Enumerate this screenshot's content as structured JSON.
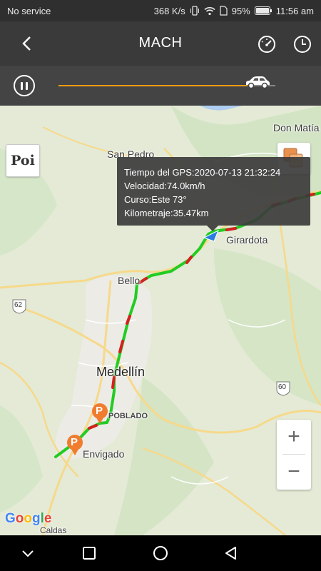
{
  "status_bar": {
    "carrier": "No service",
    "speed": "368 K/s",
    "battery": "95%",
    "time": "11:56 am"
  },
  "header": {
    "title": "MACH",
    "icons": [
      "back-icon",
      "speedometer-icon",
      "clock-icon"
    ]
  },
  "playback": {
    "state": "paused",
    "progress": 0.87
  },
  "map": {
    "poi_label": "Poi",
    "places": {
      "don_matias": "Don Matía",
      "san_pedro": "San Pedro",
      "girardota": "Girardota",
      "bello": "Bello",
      "medellin": "Medellín",
      "poblado": "POBLADO",
      "envigado": "Envigado",
      "caldas": "Caldas",
      "route_62": "62",
      "route_60": "60"
    },
    "popup": {
      "gps_time": "Tiempo del GPS:2020-07-13 21:32:24",
      "speed": "Velocidad:74.0km/h",
      "heading": "Curso:Este  73°",
      "mileage": "Kilometraje:35.47km"
    },
    "parking_marker_label": "P",
    "zoom_in": "+",
    "zoom_out": "−",
    "attribution": "Google",
    "colors": {
      "route_ok": "#22cc22",
      "route_slow": "#d62020",
      "accent": "#f39c12",
      "parking": "#f07c30",
      "vehicle": "#2a7de1"
    }
  },
  "nav_bar": {
    "icons": [
      "back-chevron-icon",
      "square-icon",
      "circle-icon",
      "triangle-icon"
    ]
  }
}
